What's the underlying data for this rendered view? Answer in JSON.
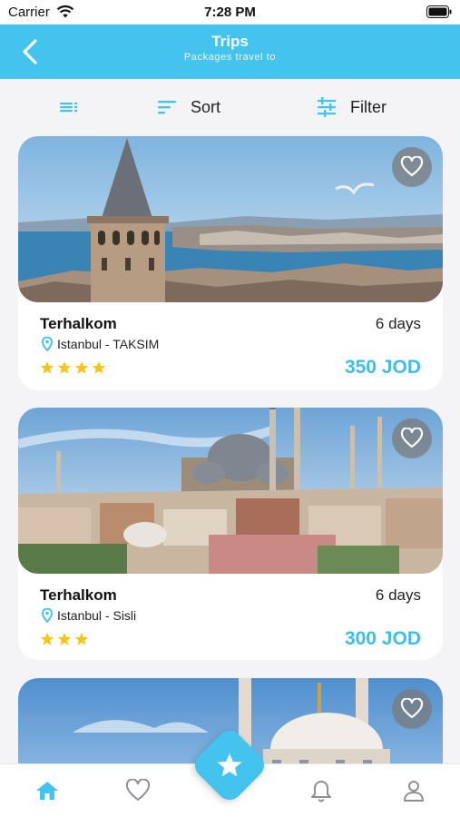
{
  "status_bar": {
    "carrier": "Carrier",
    "time": "7:28 PM"
  },
  "header": {
    "title": "Trips",
    "subtitle": "Packages travel to"
  },
  "toolbar": {
    "sort_label": "Sort",
    "filter_label": "Filter"
  },
  "trips": [
    {
      "name": "Terhalkom",
      "duration": "6 days",
      "location": "Istanbul - TAKSIM",
      "rating": 4,
      "price": "350 JOD"
    },
    {
      "name": "Terhalkom",
      "duration": "6 days",
      "location": "Istanbul - Sisli",
      "rating": 3,
      "price": "300 JOD"
    }
  ],
  "nav": {
    "items": [
      "home-icon",
      "heart-icon",
      "star-icon",
      "bell-icon",
      "user-icon"
    ],
    "active": "home-icon"
  },
  "colors": {
    "accent": "#43c3ee",
    "price": "#3fbde9",
    "star": "#f5c518"
  }
}
